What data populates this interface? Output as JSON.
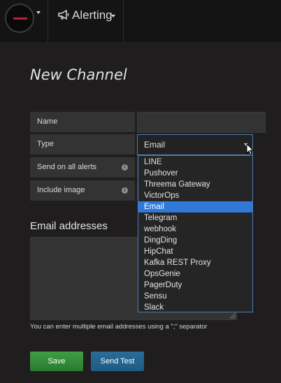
{
  "topbar": {
    "section_title": "Alerting"
  },
  "page": {
    "title": "New Channel"
  },
  "form": {
    "name_label": "Name",
    "name_value": "",
    "type_label": "Type",
    "type_value": "Email",
    "send_all_label": "Send on all alerts",
    "include_image_label": "Include image"
  },
  "email": {
    "heading": "Email addresses",
    "value": "",
    "help": "You can enter multiple email addresses using a \";\" separator"
  },
  "buttons": {
    "save": "Save",
    "send_test": "Send Test"
  },
  "dropdown": {
    "options": [
      "LINE",
      "Pushover",
      "Threema Gateway",
      "VictorOps",
      "Email",
      "Telegram",
      "webhook",
      "DingDing",
      "HipChat",
      "Kafka REST Proxy",
      "OpsGenie",
      "PagerDuty",
      "Sensu",
      "Slack"
    ],
    "selected": "Email"
  },
  "colors": {
    "save": "#3f9e44",
    "send_test": "#2b6c99",
    "highlight": "#3179d8",
    "focus_border": "#4e7fb5"
  }
}
